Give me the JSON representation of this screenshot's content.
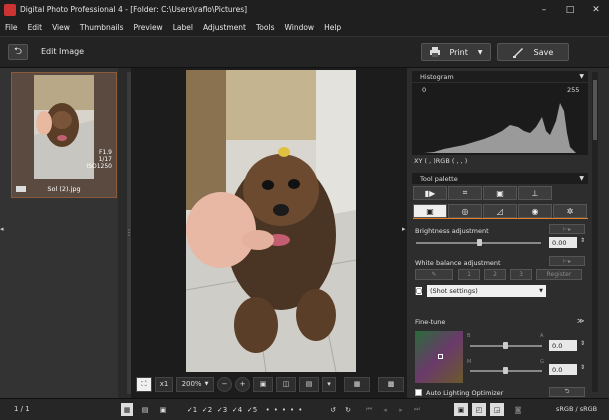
{
  "window": {
    "title": "Digital Photo Professional 4 - [Folder: C:\\Users\\raflo\\Pictures]",
    "minimize_glyph": "–",
    "maximize_glyph": "□",
    "close_glyph": "✕"
  },
  "menu": [
    "File",
    "Edit",
    "View",
    "Thumbnails",
    "Preview",
    "Label",
    "Adjustment",
    "Tools",
    "Window",
    "Help"
  ],
  "toolbar": {
    "back_glyph": "⮌",
    "edit_image_label": "Edit Image",
    "print_label": "Print",
    "save_label": "Save"
  },
  "thumbnail": {
    "aperture": "F1.9",
    "shutter": "1/17",
    "iso": "ISO1250",
    "filename": "Sol (2).jpg"
  },
  "histogram": {
    "title": "Histogram",
    "min_label": "0",
    "max_label": "255",
    "readout": "XY (    ,    )RGB (    ,    ,    )"
  },
  "tool_palette": {
    "title": "Tool palette",
    "brightness_label": "Brightness adjustment",
    "brightness_value": "0.00",
    "white_balance_label": "White balance adjustment",
    "wb_buttons": [
      "1",
      "2",
      "3"
    ],
    "register_label": "Register",
    "wb_preset": "(Shot settings)",
    "finetune_label": "Fine-tune",
    "finetune_value_1": "0.0",
    "finetune_value_2": "0.0",
    "alo_label": "Auto Lighting Optimizer"
  },
  "viewer": {
    "zoom_fit_glyph": "⛶",
    "zoom_1x": "x1",
    "zoom_level": "200%"
  },
  "status": {
    "page_count": "1 / 1",
    "ratings": [
      "✓1",
      "✓2",
      "✓3",
      "✓4",
      "✓5"
    ],
    "color_space": "sRGB / sRGB"
  },
  "colors": {
    "accent_orange": "#e67e22",
    "panel_dark": "#1f1f1f",
    "panel_mid": "#2d2d2d"
  }
}
